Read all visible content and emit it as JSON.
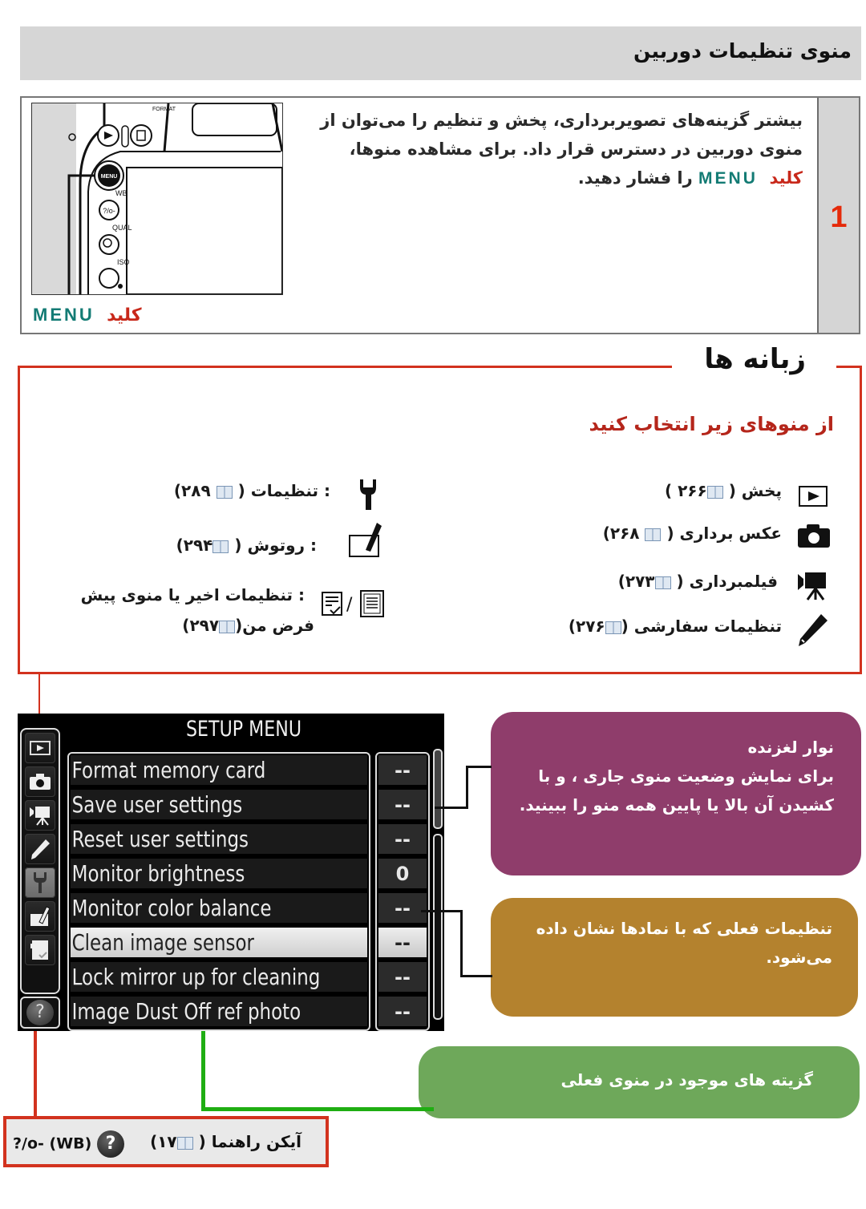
{
  "header": {
    "title": "منوی تنظیمات دوربین"
  },
  "step": {
    "number": "1",
    "text_part1": "بیشتر گزینه‌های تصویربرداری، پخش و تنظیم را می‌توان از منوی دوربین در دسترس قرار داد. برای مشاهده منوها، ",
    "key_word": "کلید",
    "key_name": "MENU",
    "text_part2": " را فشار دهید.",
    "illustration_caption_word": "کلید",
    "illustration_caption_key": "MENU",
    "illustration_labels": {
      "menu_button": "MENU",
      "wb": "WB",
      "qual": "QUAL",
      "iso": "ISO",
      "format": "FORMAT"
    }
  },
  "tabs_section": {
    "title": "زبانه ها",
    "subtitle": "از منوهای زیر انتخاب کنید",
    "right_items": [
      {
        "icon": "playback-icon",
        "label": "پخش (",
        "page": "۲۶۶",
        "close": " )"
      },
      {
        "icon": "camera-icon",
        "label": "عکس برداری (",
        "page": "۲۶۸",
        "close": ")"
      },
      {
        "icon": "movie-camera-icon",
        "label": "فیلمبرداری (",
        "page": "۲۷۳",
        "close": ")"
      },
      {
        "icon": "pencil-icon",
        "label": "تنظیمات سفارشی (",
        "page": "۲۷۶",
        "close": ")"
      }
    ],
    "left_items": [
      {
        "icon": "wrench-icon",
        "label": ": تنظیمات (",
        "page": "۲۸۹",
        "close": ")"
      },
      {
        "icon": "retouch-icon",
        "label": ": روتوش (",
        "page": "۲۹۴",
        "close": ")"
      },
      {
        "icon": "recent-settings-icon",
        "label": ": تنظیمات اخیر یا منوی پیش",
        "label2": "فرض من(",
        "page": "۲۹۷",
        "close": ")"
      }
    ]
  },
  "camera_screen": {
    "title": "SETUP MENU",
    "sidebar_tabs": [
      "playback",
      "photo-shooting",
      "movie-shooting",
      "custom-settings",
      "setup",
      "retouch",
      "my-menu"
    ],
    "active_tab": "setup",
    "help_symbol": "?",
    "items": [
      {
        "label": "Format memory card",
        "value": "--"
      },
      {
        "label": "Save user settings",
        "value": "--"
      },
      {
        "label": "Reset user settings",
        "value": "--"
      },
      {
        "label": "Monitor brightness",
        "value": "0"
      },
      {
        "label": "Monitor color balance",
        "value": "--"
      },
      {
        "label": "Clean image sensor",
        "value": "--"
      },
      {
        "label": "Lock mirror up for cleaning",
        "value": "--"
      },
      {
        "label": "Image Dust Off ref photo",
        "value": "--"
      }
    ],
    "selected_index": 5
  },
  "callouts": {
    "slider": {
      "line1": "نوار لغزنده",
      "line2": "برای نمایش وضعیت منوی جاری ، و با کشیدن آن بالا یا پایین همه منو را ببینید."
    },
    "current_settings": "تنظیمات فعلی که با نمادها نشان داده می‌شود.",
    "options": "گزیته های موجود در منوی فعلی"
  },
  "help": {
    "label": "آیکن راهنما (",
    "page": "۱۷",
    "close": ")",
    "symbol": "?",
    "wb": "(WB)",
    "key_symbol": "?/o-"
  },
  "colors": {
    "red": "#d2321e",
    "teal": "#137b74",
    "purple": "#8f3d6b",
    "brown": "#b4822e",
    "green": "#6ea85a"
  }
}
